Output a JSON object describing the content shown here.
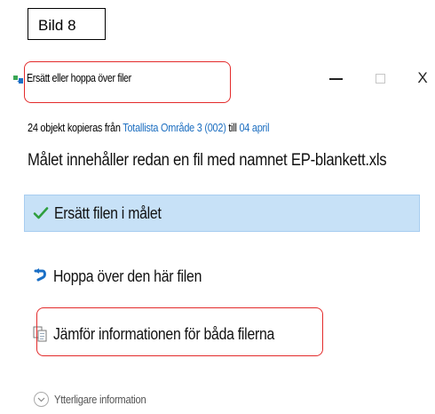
{
  "annotation": {
    "label": "Bild 8"
  },
  "dialog": {
    "title": "Ersätt eller hoppa över filer",
    "window_controls": {
      "minimize": "minimize-icon",
      "maximize": "maximize-icon",
      "close": "X"
    },
    "info": {
      "prefix": "24 objekt kopieras från ",
      "source_1": "Totallista",
      "separator": "  ",
      "source_2": "Område 3 (002)",
      "middle": " till ",
      "destination": "04 april"
    },
    "heading": "Målet innehåller redan en fil med namnet EP-blankett.xls",
    "options": [
      {
        "label": "Ersätt filen i målet",
        "icon": "checkmark-icon",
        "selected": true
      },
      {
        "label": "Hoppa över den här filen",
        "icon": "skip-arrow-icon",
        "selected": false
      },
      {
        "label": "Jämför informationen för båda filerna",
        "icon": "compare-files-icon",
        "selected": false
      }
    ],
    "more_info": {
      "label": "Ytterligare information",
      "icon": "chevron-down-icon"
    }
  },
  "colors": {
    "selected_bg": "#c7e1f7",
    "link": "#1d6fc1",
    "annotation_outline": "#e32b2b",
    "checkmark": "#2e9e3e",
    "skip_arrow": "#1a6fc6"
  }
}
